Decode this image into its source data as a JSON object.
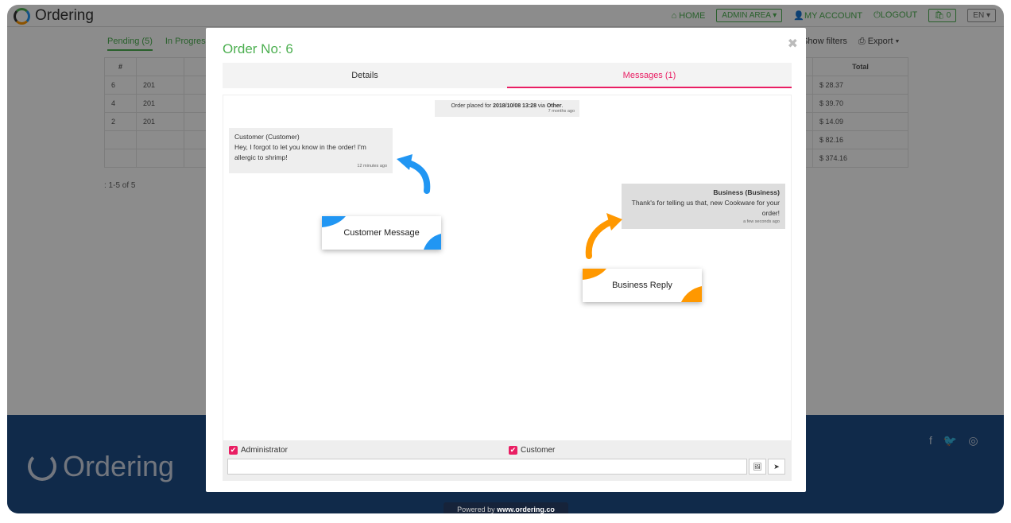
{
  "app": {
    "name": "Ordering"
  },
  "nav": {
    "home": "HOME",
    "admin": "ADMIN AREA",
    "account": "MY ACCOUNT",
    "logout": "LOGOUT",
    "cart_count": "0",
    "lang": "EN"
  },
  "bg_tabs": {
    "pending": "Pending (5)",
    "in_progress": "In Progress",
    "show_filters": "Show filters",
    "export": "Export"
  },
  "bg_table": {
    "headers": [
      "#",
      "Total"
    ],
    "rows": [
      {
        "id": "6",
        "frag": "201",
        "total": "$ 28.37"
      },
      {
        "id": "4",
        "frag": "201",
        "total": "$ 39.70"
      },
      {
        "id": "2",
        "frag": "201",
        "total": "$ 14.09"
      },
      {
        "id": "",
        "frag": "",
        "total": "$ 82.16"
      },
      {
        "id": "",
        "frag": "",
        "total": "$ 374.16"
      }
    ],
    "pagecount": ": 1-5 of 5"
  },
  "footer": {
    "powered_prefix": "Powered by",
    "powered_site": "www.ordering.co"
  },
  "modal": {
    "title": "Order No: 6",
    "close": "✖",
    "tabs": {
      "details": "Details",
      "messages": "Messages (1)"
    },
    "system": {
      "prefix": "Order placed for",
      "date": "2018/10/08 13:28",
      "via": "via",
      "channel": "Other",
      "time": "7 months ago"
    },
    "customer_msg": {
      "sender": "Customer (Customer)",
      "text": "Hey, I forgot to let you know in the order! I'm allergic to shrimp!",
      "time": "12 minutes ago"
    },
    "business_msg": {
      "sender": "Business (Business)",
      "text": "Thank's for telling us that, new Cookware for your order!",
      "time": "a few seconds ago"
    },
    "callout_customer": "Customer Message",
    "callout_business": "Business Reply",
    "check_admin": "Administrator",
    "check_customer": "Customer",
    "input_value": ""
  }
}
